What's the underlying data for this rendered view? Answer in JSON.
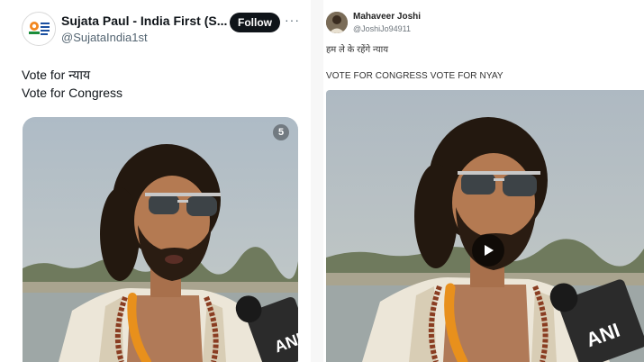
{
  "left_tweet": {
    "display_name": "Sujata Paul - India First (S...",
    "handle": "@SujataIndia1st",
    "follow_label": "Follow",
    "more_label": "···",
    "text_lines": [
      "Vote for न्याय",
      "Vote for Congress"
    ],
    "media_badge_label": "5",
    "mic_label": "ANI",
    "icons": {
      "avatar": "party-logo-avatar",
      "verified": "verified-badge-icon",
      "more": "more-options-icon"
    }
  },
  "right_tweet": {
    "display_name": "Mahaveer Joshi",
    "handle": "@JoshiJo94911",
    "hindi_text": "हम ले के रहेंगे न्याय",
    "caption": "VOTE FOR CONGRESS VOTE FOR NYAY",
    "mic_label": "ANI",
    "icons": {
      "avatar": "user-avatar",
      "play": "play-icon"
    }
  },
  "colors": {
    "follow_bg": "#0f1419",
    "verified_blue": "#1d9bf0",
    "sky": "#b8c3cc",
    "shawl": "#ece6d8",
    "marigold": "#e8901c"
  }
}
